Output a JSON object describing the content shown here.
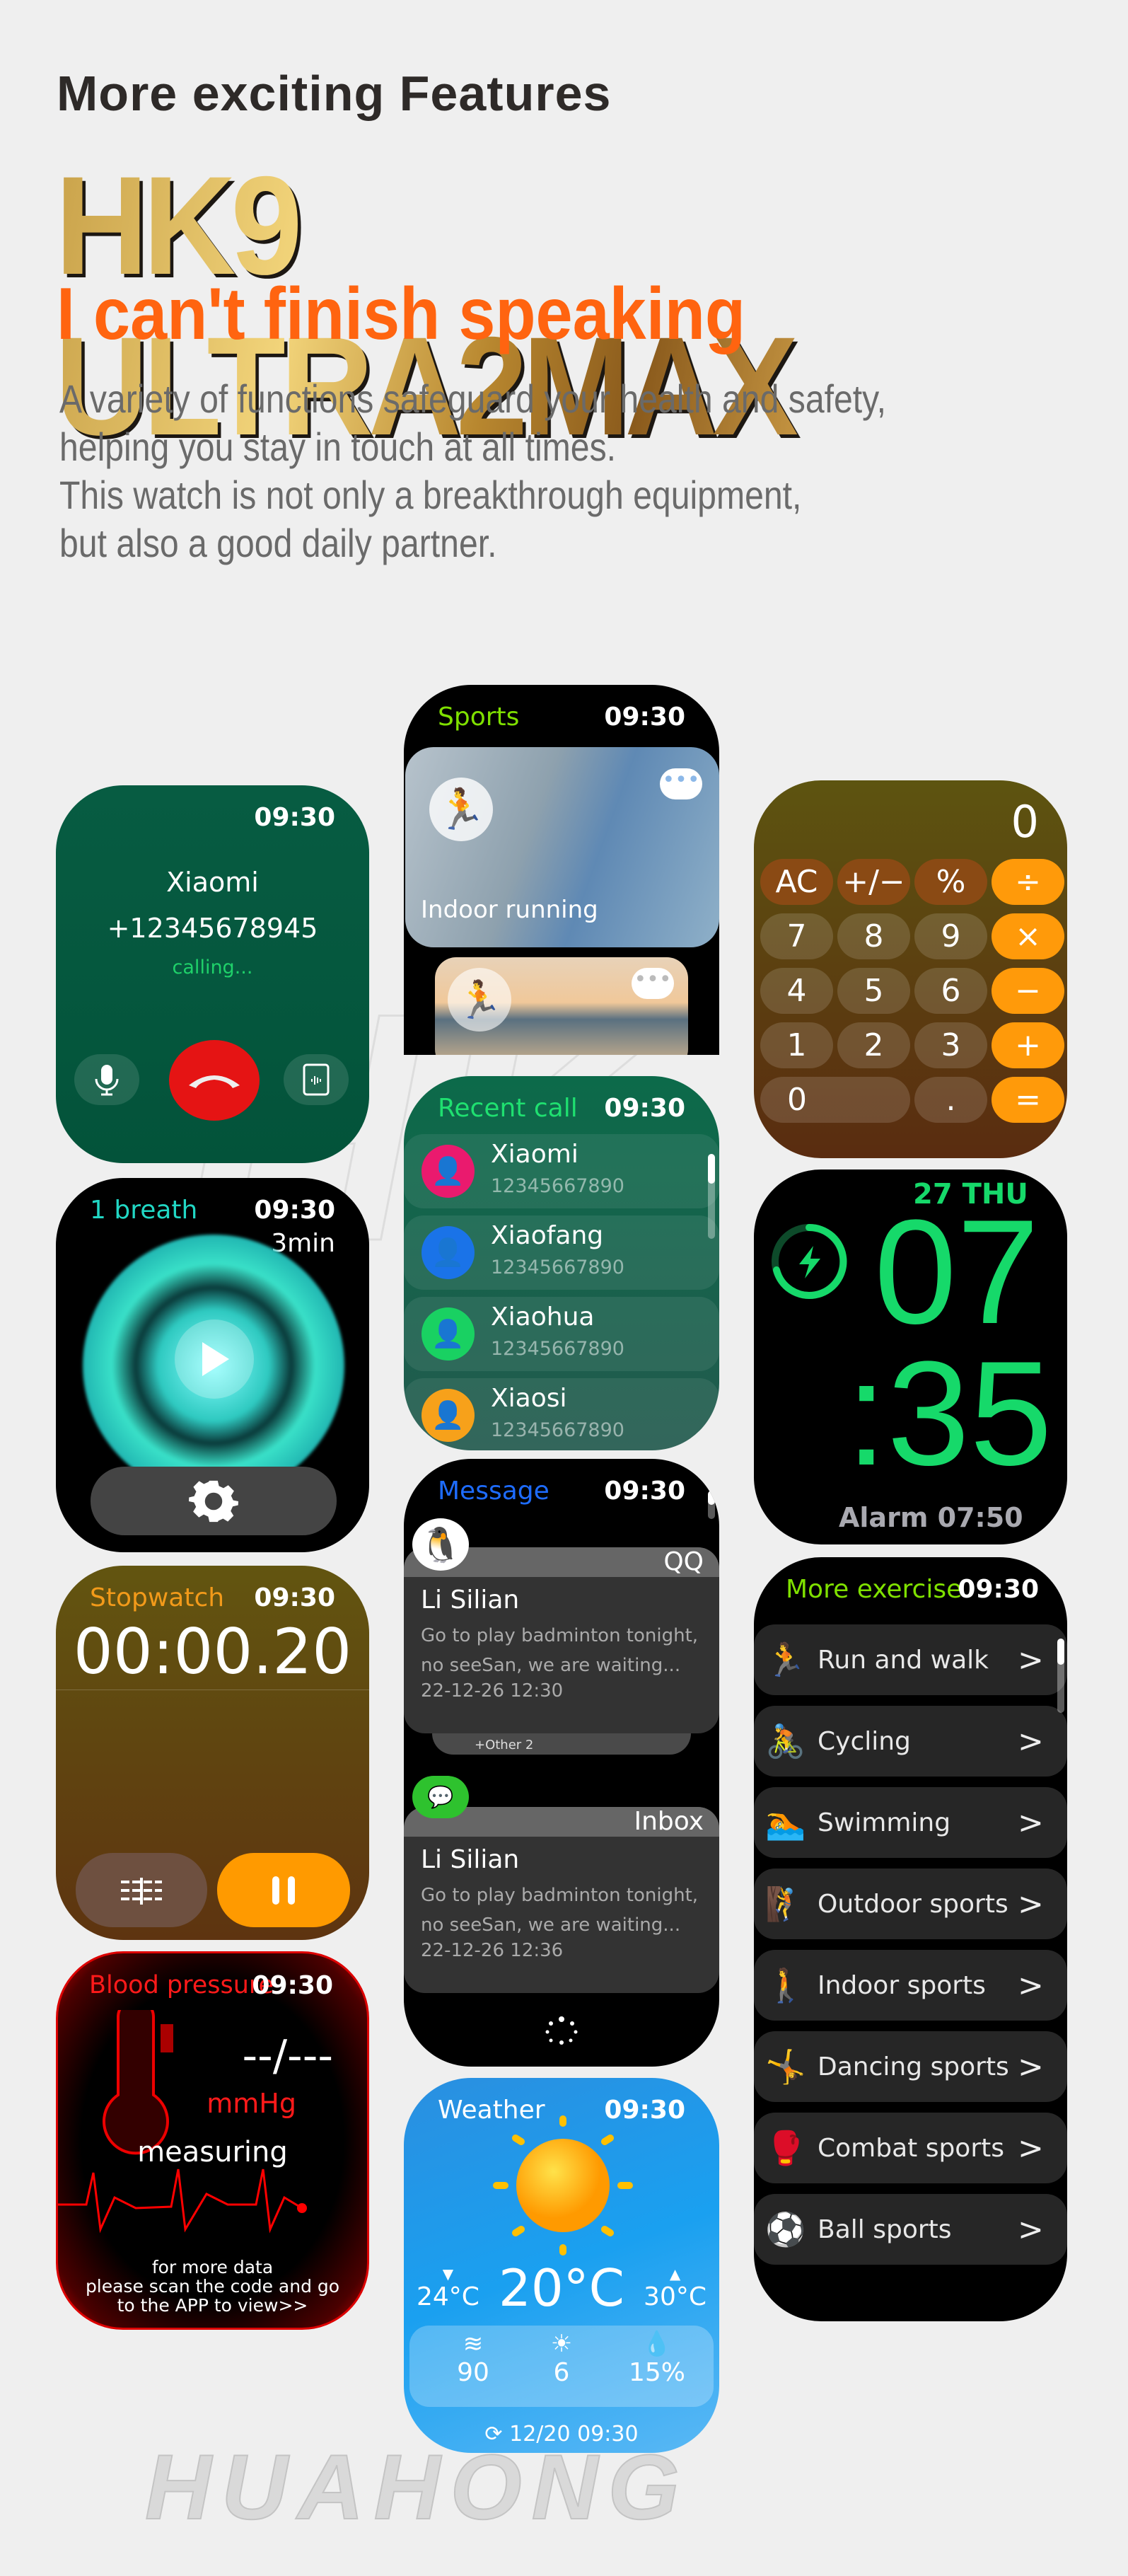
{
  "header": {
    "subtitle": "More exciting Features",
    "brand": "HK9 ULTRA2MAX",
    "slogan": "I can't finish speaking",
    "description": [
      "A variety of functions safeguard your health and safety,",
      "helping you stay in touch at all times.",
      "This watch is not only a breakthrough equipment,",
      "but also a good daily partner."
    ]
  },
  "colors": {
    "accent_orange": "#ff6410",
    "gold": "#c9a24a",
    "sport_green": "#7fe000",
    "clock_green": "#16d96a",
    "message_blue": "#1e6cff"
  },
  "watermark": {
    "logo": "HK",
    "text": "HUAHONG"
  },
  "call": {
    "time": "09:30",
    "name": "Xiaomi",
    "number": "+12345678945",
    "status": "calling...",
    "icons": [
      "microphone-icon",
      "hang-up-icon",
      "phone-audio-icon"
    ]
  },
  "breath": {
    "title": "1 breath",
    "time": "09:30",
    "duration": "3min",
    "icons": [
      "play-icon",
      "gear-icon"
    ]
  },
  "stopwatch": {
    "title": "Stopwatch",
    "time": "09:30",
    "elapsed": "00:00.20",
    "icons": [
      "lap-icon",
      "pause-icon"
    ]
  },
  "blood_pressure": {
    "title": "Blood pressure",
    "time": "09:30",
    "value": "--/---",
    "unit": "mmHg",
    "status": "measuring",
    "footer": [
      "for more data",
      "please scan the code and go",
      "to the APP to view>>"
    ]
  },
  "sports": {
    "title": "Sports",
    "time": "09:30",
    "cards": [
      {
        "label": "Indoor running",
        "icon": "treadmill-icon"
      },
      {
        "label": "",
        "icon": "running-icon"
      }
    ]
  },
  "recent_call": {
    "title": "Recent call",
    "time": "09:30",
    "contacts": [
      {
        "name": "Xiaomi",
        "number": "12345667890",
        "color": "#ea1a6e"
      },
      {
        "name": "Xiaofang",
        "number": "12345667890",
        "color": "#1a73e8"
      },
      {
        "name": "Xiaohua",
        "number": "12345667890",
        "color": "#19d162"
      },
      {
        "name": "Xiaosi",
        "number": "12345667890",
        "color": "#f7a11a"
      }
    ]
  },
  "message": {
    "title": "Message",
    "time": "09:30",
    "items": [
      {
        "app": "QQ",
        "sender": "Li Silian",
        "line1": "Go to play badminton tonight,",
        "line2": "no seeSan, we are waiting...",
        "date": "22-12-26  12:30",
        "more": "+Other 2"
      },
      {
        "app": "Inbox",
        "sender": "Li Silian",
        "line1": "Go to play badminton tonight,",
        "line2": "no seeSan, we are waiting...",
        "date": "22-12-26  12:36"
      }
    ]
  },
  "weather": {
    "title": "Weather",
    "time": "09:30",
    "low": "24°C",
    "current": "20°C",
    "high": "30°C",
    "wind": "90",
    "uv": "6",
    "humidity": "15%",
    "updated": "12/20  09:30"
  },
  "calculator": {
    "display": "0",
    "keys": [
      [
        "AC",
        "+/−",
        "%",
        "÷"
      ],
      [
        "7",
        "8",
        "9",
        "×"
      ],
      [
        "4",
        "5",
        "6",
        "−"
      ],
      [
        "1",
        "2",
        "3",
        "+"
      ],
      [
        "0",
        ".",
        "="
      ]
    ]
  },
  "clock": {
    "date": "27 THU",
    "hour": "07",
    "minute": ":35",
    "alarm": "Alarm 07:50",
    "icon": "charging-icon"
  },
  "more_exercise": {
    "title": "More exercise",
    "time": "09:30",
    "items": [
      {
        "label": "Run and walk",
        "icon": "running-icon",
        "color": "#f5c400"
      },
      {
        "label": "Cycling",
        "icon": "cycling-icon",
        "color": "#f59a00"
      },
      {
        "label": "Swimming",
        "icon": "swimming-icon",
        "color": "#f5c400"
      },
      {
        "label": "Outdoor sports",
        "icon": "climbing-icon",
        "color": "#1e9bff"
      },
      {
        "label": "Indoor sports",
        "icon": "treadmill-icon",
        "color": "#f59a00"
      },
      {
        "label": "Dancing sports",
        "icon": "dancing-icon",
        "color": "#f5d000"
      },
      {
        "label": "Combat sports",
        "icon": "boxing-icon",
        "color": "#6ee000"
      },
      {
        "label": "Ball sports",
        "icon": "ball-sports-icon",
        "color": "#f5c400"
      }
    ]
  }
}
